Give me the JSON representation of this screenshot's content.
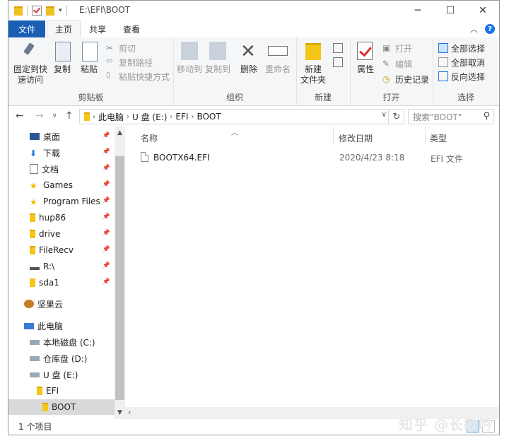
{
  "title": {
    "path": "E:\\EFI\\BOOT"
  },
  "tabs": {
    "file": "文件",
    "home": "主页",
    "share": "共享",
    "view": "查看"
  },
  "ribbon": {
    "clipboard": {
      "pin": "固定到快\n速访问",
      "copy": "复制",
      "paste": "粘贴",
      "cut": "剪切",
      "copy_path": "复制路径",
      "paste_shortcut": "粘贴快捷方式",
      "label": "剪贴板"
    },
    "organize": {
      "move_to": "移动到",
      "copy_to": "复制到",
      "delete": "删除",
      "rename": "重命名",
      "label": "组织"
    },
    "new": {
      "new_folder": "新建\n文件夹",
      "label": "新建"
    },
    "open": {
      "properties": "属性",
      "open": "打开",
      "edit": "编辑",
      "history": "历史记录",
      "label": "打开"
    },
    "select": {
      "select_all": "全部选择",
      "select_none": "全部取消",
      "invert": "反向选择",
      "label": "选择"
    }
  },
  "address": {
    "crumbs": [
      "此电脑",
      "U 盘 (E:)",
      "EFI",
      "BOOT"
    ],
    "search_placeholder": "搜索\"BOOT\""
  },
  "nav": {
    "quick": [
      {
        "label": "桌面"
      },
      {
        "label": "下载"
      },
      {
        "label": "文档"
      },
      {
        "label": "Games"
      },
      {
        "label": "Program Files"
      },
      {
        "label": "hup86"
      },
      {
        "label": "drive"
      },
      {
        "label": "FileRecv"
      },
      {
        "label": "R:\\"
      },
      {
        "label": "sda1"
      }
    ],
    "jianguoyun": "坚果云",
    "this_pc": "此电脑",
    "drives": [
      {
        "label": "本地磁盘 (C:)"
      },
      {
        "label": "仓库盘 (D:)"
      },
      {
        "label": "U 盘 (E:)"
      }
    ],
    "efi": "EFI",
    "boot": "BOOT"
  },
  "columns": {
    "name": "名称",
    "date": "修改日期",
    "type": "类型"
  },
  "files": [
    {
      "name": "BOOTX64.EFI",
      "date": "2020/4/23 8:18",
      "type": "EFI 文件"
    }
  ],
  "status": {
    "count": "1 个项目"
  },
  "watermark": "知乎 @长歌吟",
  "colors": {
    "accent": "#1a5fb4",
    "folder": "#f5c518"
  }
}
